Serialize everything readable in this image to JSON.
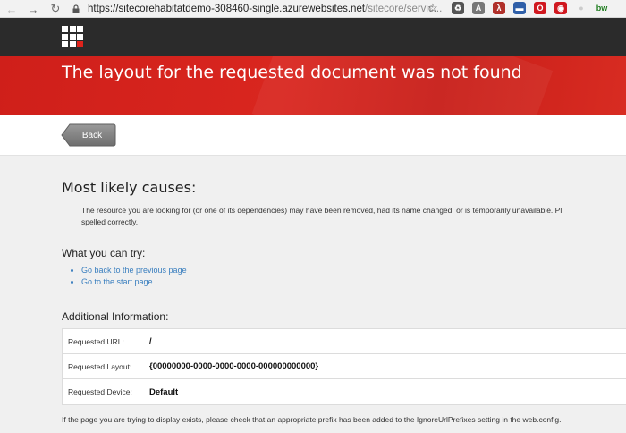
{
  "browser": {
    "url_host": "https://sitecorehabitatdemo-308460-single.azurewebsites.net",
    "url_path": "/sitecore/servic...",
    "back_icon": "arrow-left-icon",
    "forward_icon": "arrow-right-icon",
    "reload_icon": "reload-icon",
    "star_icon": "star-icon",
    "extensions": [
      {
        "name": "recycle-icon",
        "color": "#555555",
        "glyph": "♻"
      },
      {
        "name": "angular-icon",
        "color": "#777777",
        "glyph": "A"
      },
      {
        "name": "acrobat-icon",
        "color": "#b0302a",
        "glyph": "λ"
      },
      {
        "name": "screen-icon",
        "color": "#2f5fa8",
        "glyph": "▬"
      },
      {
        "name": "opera-icon",
        "color": "#d0181f",
        "glyph": "O"
      },
      {
        "name": "ring-icon",
        "color": "#d0181f",
        "glyph": "◉"
      },
      {
        "name": "circle-icon",
        "color": "#cccccc",
        "glyph": "●"
      },
      {
        "name": "bw-icon",
        "color": "#1a7a1a",
        "glyph": "bw"
      }
    ]
  },
  "header": {
    "logo_icon": "sitecore-logo-icon"
  },
  "banner": {
    "title": "The layout for the requested document was not found"
  },
  "back_button": {
    "label": "Back"
  },
  "causes": {
    "heading": "Most likely causes:",
    "item_line1": "The resource you are looking for (or one of its dependencies) may have been removed, had its name changed, or is temporarily unavailable. Pl",
    "item_line2": "spelled correctly."
  },
  "try": {
    "heading": "What you can try:",
    "links": [
      "Go back to the previous page",
      "Go to the start page"
    ]
  },
  "info": {
    "heading": "Additional Information:",
    "rows": [
      {
        "key": "Requested URL:",
        "value": "/"
      },
      {
        "key": "Requested Layout:",
        "value": "{00000000-0000-0000-0000-000000000000}"
      },
      {
        "key": "Requested Device:",
        "value": "Default"
      }
    ]
  },
  "footer": {
    "note": "If the page you are trying to display exists, please check that an appropriate prefix has been added to the IgnoreUrlPrefixes setting in the web.config."
  }
}
